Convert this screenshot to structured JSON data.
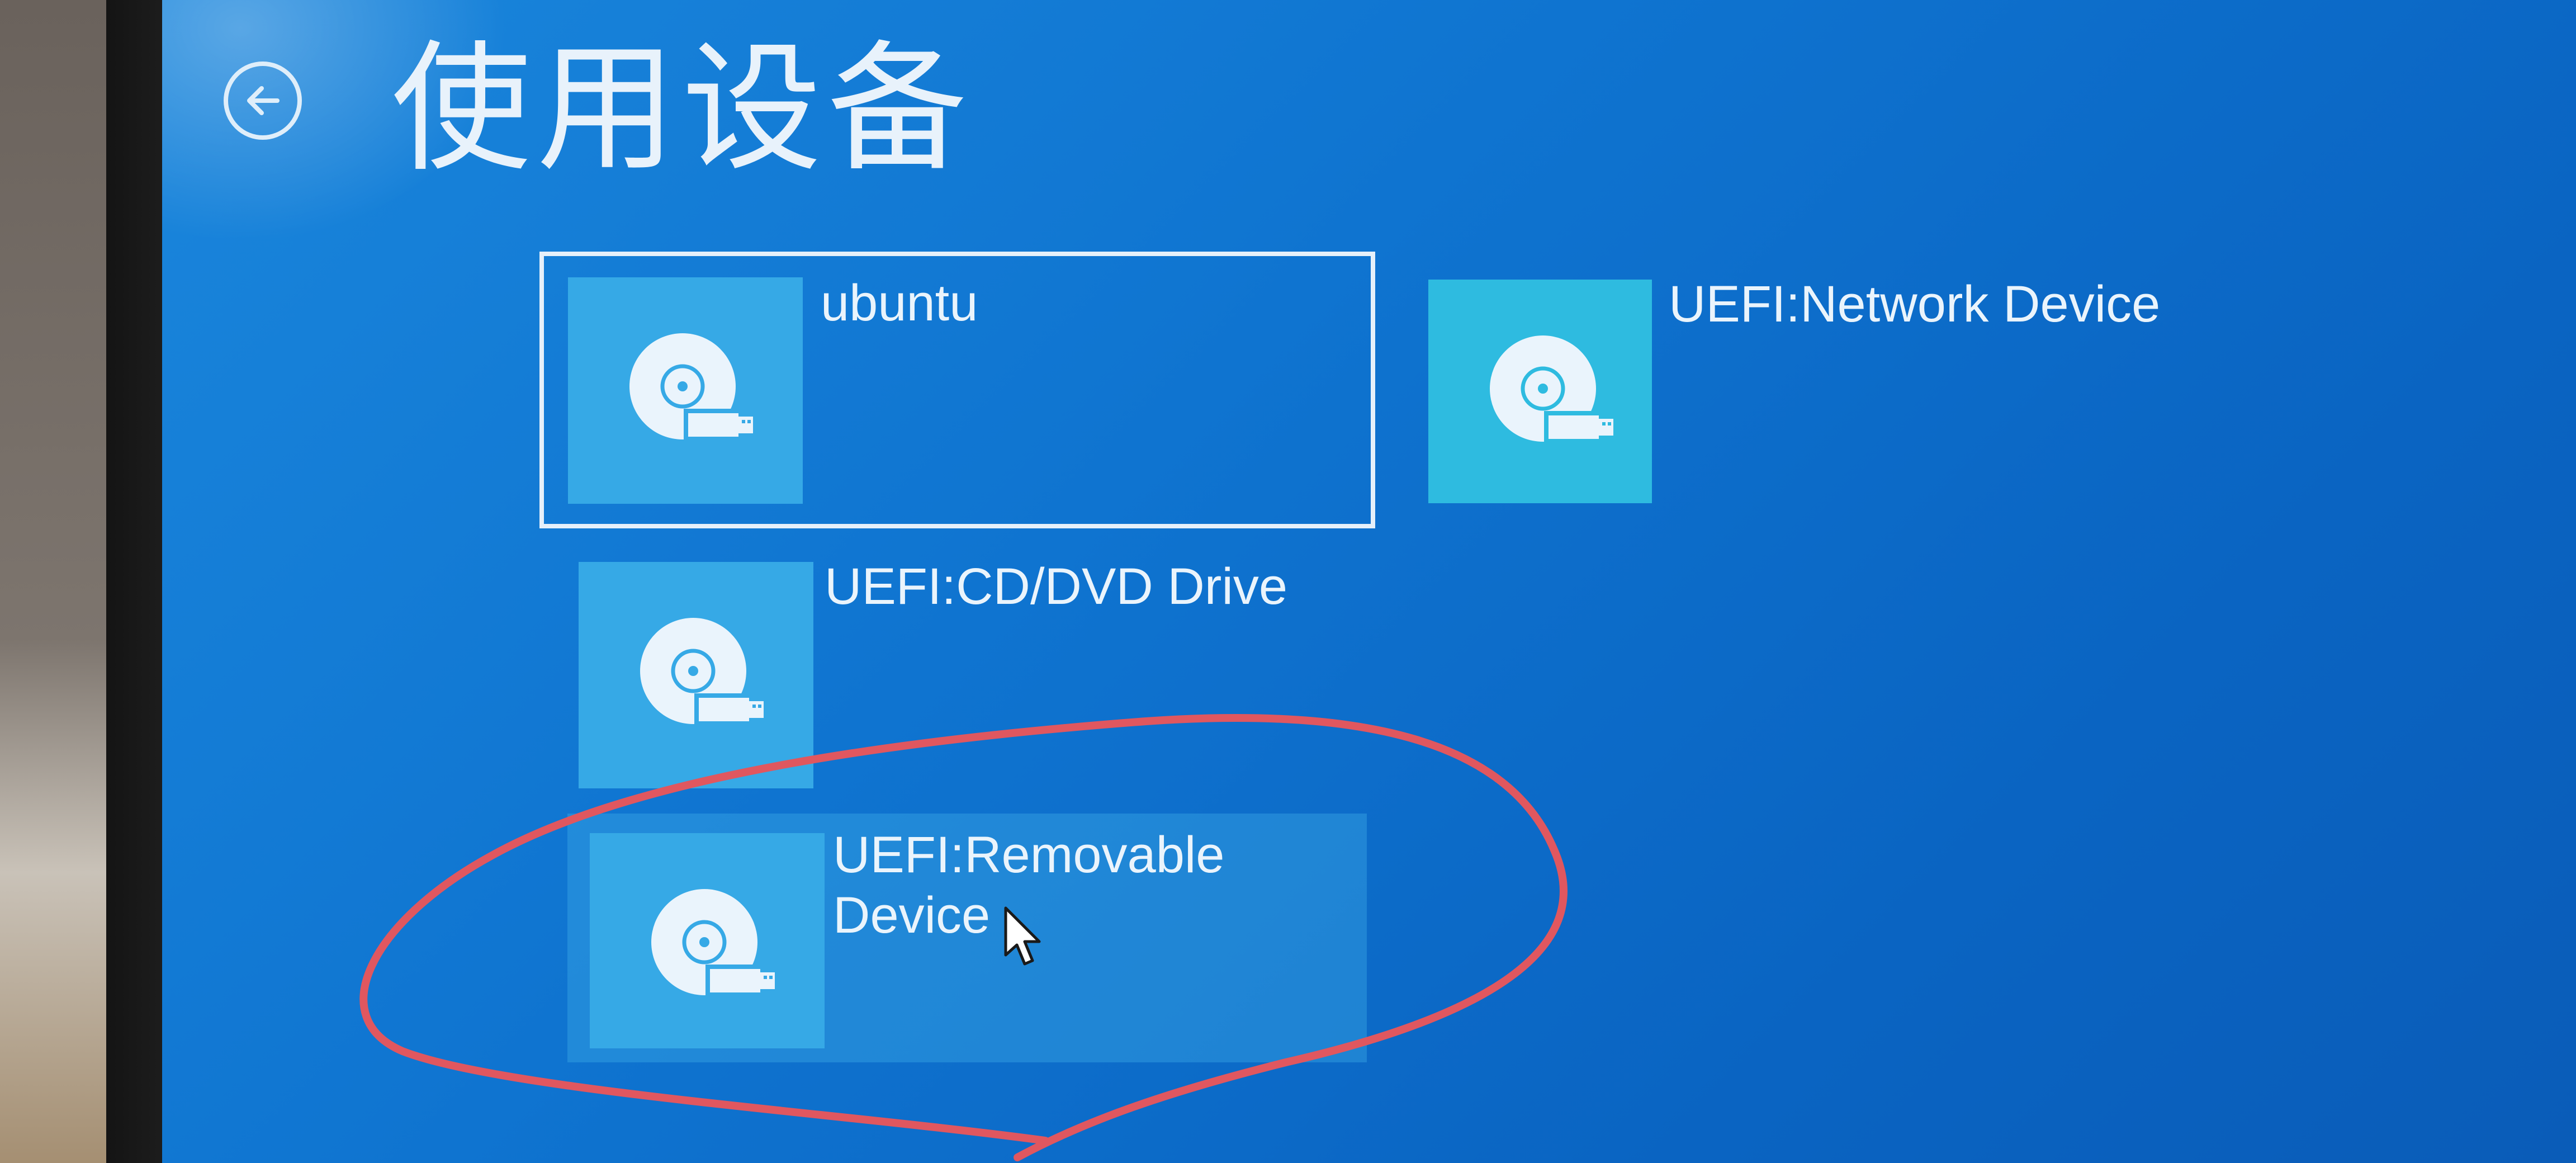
{
  "screen": {
    "title": "使用设备",
    "back_icon": "back-arrow-icon"
  },
  "devices": [
    {
      "label": "ubuntu",
      "icon": "usb-disc-icon",
      "state": "selected"
    },
    {
      "label": "UEFI:Network Device",
      "icon": "usb-disc-icon",
      "state": "normal"
    },
    {
      "label": "UEFI:CD/DVD Drive",
      "icon": "usb-disc-icon",
      "state": "normal"
    },
    {
      "label": "UEFI:Removable\nDevice",
      "icon": "usb-disc-icon",
      "state": "hover"
    }
  ],
  "annotation": {
    "color": "#e0575f",
    "shape": "hand-drawn circle around UEFI:Removable Device"
  },
  "colors": {
    "background": "#0f74d0",
    "tile": "#36a9e6",
    "text": "#eaf4fc",
    "selection_border": "#e6f0fa"
  }
}
